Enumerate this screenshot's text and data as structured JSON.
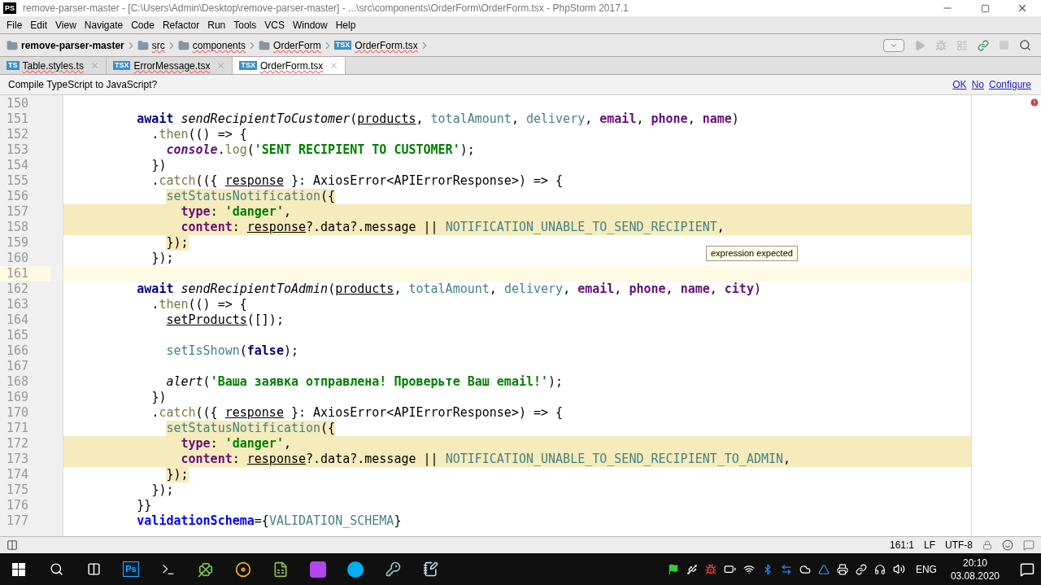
{
  "window": {
    "title": "remove-parser-master - [C:\\Users\\Admin\\Desktop\\remove-parser-master] - ...\\src\\components\\OrderForm\\OrderForm.tsx - PhpStorm 2017.1",
    "app_badge": "PS"
  },
  "menu": [
    "File",
    "Edit",
    "View",
    "Navigate",
    "Code",
    "Refactor",
    "Run",
    "Tools",
    "VCS",
    "Window",
    "Help"
  ],
  "breadcrumbs": [
    {
      "label": "remove-parser-master",
      "kind": "folder"
    },
    {
      "label": "src",
      "kind": "folder"
    },
    {
      "label": "components",
      "kind": "folder"
    },
    {
      "label": "OrderForm",
      "kind": "folder"
    },
    {
      "label": "OrderForm.tsx",
      "kind": "file",
      "badge": "TSX"
    }
  ],
  "tabs": [
    {
      "label": "Table.styles.ts",
      "badge": "TS",
      "selected": false
    },
    {
      "label": "ErrorMessage.tsx",
      "badge": "TSX",
      "selected": false
    },
    {
      "label": "OrderForm.tsx",
      "badge": "TSX",
      "selected": true
    }
  ],
  "notification": {
    "text": "Compile TypeScript to JavaScript?",
    "links": [
      "OK",
      "No",
      "Configure"
    ]
  },
  "editor": {
    "lines": [
      {
        "number": "150"
      },
      {
        "number": "151",
        "tokens": [
          {
            "kind": "keyword",
            "text": "          await "
          },
          {
            "kind": "call",
            "text": "sendRecipientToCustomer"
          },
          {
            "kind": "plain",
            "text": "("
          },
          {
            "kind": "var",
            "text": "products"
          },
          {
            "kind": "plain",
            "text": ", "
          },
          {
            "kind": "field",
            "text": "totalAmount"
          },
          {
            "kind": "plain",
            "text": ", "
          },
          {
            "kind": "field",
            "text": "delivery"
          },
          {
            "kind": "plain",
            "text": ", "
          },
          {
            "kind": "prop",
            "text": "email"
          },
          {
            "kind": "plain",
            "text": ", "
          },
          {
            "kind": "prop",
            "text": "phone"
          },
          {
            "kind": "plain",
            "text": ", "
          },
          {
            "kind": "prop",
            "text": "name"
          },
          {
            "kind": "plain",
            "text": ")"
          }
        ]
      },
      {
        "number": "152",
        "tokens": [
          {
            "kind": "plain",
            "text": "            ."
          },
          {
            "kind": "method",
            "text": "then"
          },
          {
            "kind": "plain",
            "text": "(() => {"
          }
        ]
      },
      {
        "number": "153",
        "tokens": [
          {
            "kind": "global",
            "text": "              console"
          },
          {
            "kind": "plain",
            "text": "."
          },
          {
            "kind": "method",
            "text": "log"
          },
          {
            "kind": "plain",
            "text": "("
          },
          {
            "kind": "string",
            "text": "'SENT RECIPIENT TO CUSTOMER'"
          },
          {
            "kind": "plain",
            "text": ");"
          }
        ]
      },
      {
        "number": "154",
        "tokens": [
          {
            "kind": "plain",
            "text": "            })"
          }
        ]
      },
      {
        "number": "155",
        "tokens": [
          {
            "kind": "plain",
            "text": "            ."
          },
          {
            "kind": "method",
            "text": "catch"
          },
          {
            "kind": "plain",
            "text": "(({ "
          },
          {
            "kind": "var",
            "text": "response"
          },
          {
            "kind": "plain",
            "text": " }: AxiosError<APIErrorResponse>) => {"
          }
        ]
      },
      {
        "number": "156",
        "highlighted": true,
        "tokens": [
          {
            "kind": "field",
            "text": "              setStatusNotification"
          },
          {
            "kind": "plain",
            "text": "({"
          }
        ]
      },
      {
        "number": "157",
        "highlighted": true,
        "full_row": true,
        "tokens": [
          {
            "kind": "prop",
            "text": "                type"
          },
          {
            "kind": "plain",
            "text": ": "
          },
          {
            "kind": "string",
            "text": "'danger'"
          },
          {
            "kind": "plain",
            "text": ","
          }
        ]
      },
      {
        "number": "158",
        "highlighted": true,
        "full_row": true,
        "tokens": [
          {
            "kind": "prop",
            "text": "                content"
          },
          {
            "kind": "plain",
            "text": ": "
          },
          {
            "kind": "var",
            "text": "response"
          },
          {
            "kind": "plain",
            "text": "?.data?.message || "
          },
          {
            "kind": "field",
            "text": "NOTIFICATION_UNABLE_TO_SEND_RECIPIENT"
          },
          {
            "kind": "plain",
            "text": ","
          }
        ]
      },
      {
        "number": "159",
        "highlighted": true,
        "tokens": [
          {
            "kind": "plain",
            "text": "              });"
          }
        ]
      },
      {
        "number": "160",
        "tokens": [
          {
            "kind": "plain",
            "text": "            });"
          }
        ]
      },
      {
        "number": "161",
        "current": true
      },
      {
        "number": "162",
        "tokens": [
          {
            "kind": "keyword",
            "text": "          await "
          },
          {
            "kind": "call",
            "text": "sendRecipientToAdmin"
          },
          {
            "kind": "plain",
            "text": "("
          },
          {
            "kind": "var",
            "text": "products"
          },
          {
            "kind": "plain",
            "text": ", "
          },
          {
            "kind": "field",
            "text": "totalAmount"
          },
          {
            "kind": "plain",
            "text": ", "
          },
          {
            "kind": "field",
            "text": "delivery"
          },
          {
            "kind": "plain",
            "text": ", "
          },
          {
            "kind": "prop",
            "text": "email"
          },
          {
            "kind": "plain",
            "text": ", "
          },
          {
            "kind": "prop",
            "text": "phone"
          },
          {
            "kind": "plain",
            "text": ", "
          },
          {
            "kind": "prop",
            "text": "name"
          },
          {
            "kind": "plain",
            "text": ", "
          },
          {
            "kind": "prop",
            "text": "city"
          },
          {
            "kind": "plain",
            "text": ")"
          }
        ]
      },
      {
        "number": "163",
        "tokens": [
          {
            "kind": "plain",
            "text": "            ."
          },
          {
            "kind": "method",
            "text": "then"
          },
          {
            "kind": "plain",
            "text": "(() => {"
          }
        ]
      },
      {
        "number": "164",
        "tokens": [
          {
            "kind": "var",
            "text": "              setProducts"
          },
          {
            "kind": "plain",
            "text": "([]);"
          }
        ]
      },
      {
        "number": "165"
      },
      {
        "number": "166",
        "tokens": [
          {
            "kind": "field",
            "text": "              setIsShown"
          },
          {
            "kind": "plain",
            "text": "("
          },
          {
            "kind": "keyword",
            "text": "false"
          },
          {
            "kind": "plain",
            "text": ");"
          }
        ]
      },
      {
        "number": "167"
      },
      {
        "number": "168",
        "tokens": [
          {
            "kind": "call",
            "text": "              alert"
          },
          {
            "kind": "plain",
            "text": "("
          },
          {
            "kind": "string",
            "text": "'Ваша заявка отправлена! Проверьте Ваш email!'"
          },
          {
            "kind": "plain",
            "text": ");"
          }
        ]
      },
      {
        "number": "169",
        "tokens": [
          {
            "kind": "plain",
            "text": "            })"
          }
        ]
      },
      {
        "number": "170",
        "tokens": [
          {
            "kind": "plain",
            "text": "            ."
          },
          {
            "kind": "method",
            "text": "catch"
          },
          {
            "kind": "plain",
            "text": "(({ "
          },
          {
            "kind": "var",
            "text": "response"
          },
          {
            "kind": "plain",
            "text": " }: AxiosError<APIErrorResponse>) => {"
          }
        ]
      },
      {
        "number": "171",
        "highlighted": true,
        "tokens": [
          {
            "kind": "field",
            "text": "              setStatusNotification"
          },
          {
            "kind": "plain",
            "text": "({"
          }
        ]
      },
      {
        "number": "172",
        "highlighted": true,
        "full_row": true,
        "tokens": [
          {
            "kind": "prop",
            "text": "                type"
          },
          {
            "kind": "plain",
            "text": ": "
          },
          {
            "kind": "string",
            "text": "'danger'"
          },
          {
            "kind": "plain",
            "text": ","
          }
        ]
      },
      {
        "number": "173",
        "highlighted": true,
        "full_row": true,
        "tokens": [
          {
            "kind": "prop",
            "text": "                content"
          },
          {
            "kind": "plain",
            "text": ": "
          },
          {
            "kind": "var",
            "text": "response"
          },
          {
            "kind": "plain",
            "text": "?.data?.message || "
          },
          {
            "kind": "field",
            "text": "NOTIFICATION_UNABLE_TO_SEND_RECIPIENT_TO_ADMIN"
          },
          {
            "kind": "plain",
            "text": ","
          }
        ]
      },
      {
        "number": "174",
        "highlighted": true,
        "tokens": [
          {
            "kind": "plain",
            "text": "              });"
          }
        ]
      },
      {
        "number": "175",
        "tokens": [
          {
            "kind": "plain",
            "text": "            });"
          }
        ]
      },
      {
        "number": "176",
        "tokens": [
          {
            "kind": "plain",
            "text": "          }}"
          }
        ]
      },
      {
        "number": "177",
        "tokens": [
          {
            "kind": "attr",
            "text": "          validationSchema"
          },
          {
            "kind": "plain",
            "text": "={"
          },
          {
            "kind": "field",
            "text": "VALIDATION_SCHEMA"
          },
          {
            "kind": "plain",
            "text": "}"
          }
        ]
      }
    ],
    "tooltip": "expression expected"
  },
  "status_bar": {
    "position": "161:1",
    "line_separator": "LF",
    "encoding": "UTF-8"
  },
  "taskbar": {
    "language": "ENG",
    "time": "20:10",
    "date": "03.08.2020",
    "ps_label": "Ps"
  }
}
